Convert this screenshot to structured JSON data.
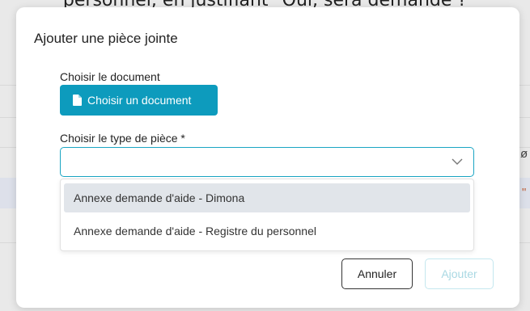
{
  "background": {
    "top_text": "personnel, en justifiant \"Oui, sera demandé ?",
    "right_glyph_1": "ø",
    "right_glyph_2": "\""
  },
  "modal": {
    "title": "Ajouter une pièce jointe",
    "document_label": "Choisir le document",
    "document_button": "Choisir un document",
    "type_label": "Choisir le type de pièce *",
    "type_value": "",
    "options": [
      "Annexe demande d'aide - Dimona",
      "Annexe demande d'aide - Registre du personnel"
    ],
    "cancel": "Annuler",
    "add": "Ajouter"
  },
  "colors": {
    "accent": "#0d9bbd",
    "select_border": "#1aa5c3",
    "highlight": "#e1e5ea",
    "disabled": "#a9d8e3"
  },
  "icons": {
    "file": "file-icon",
    "chevron": "chevron-down-icon"
  }
}
